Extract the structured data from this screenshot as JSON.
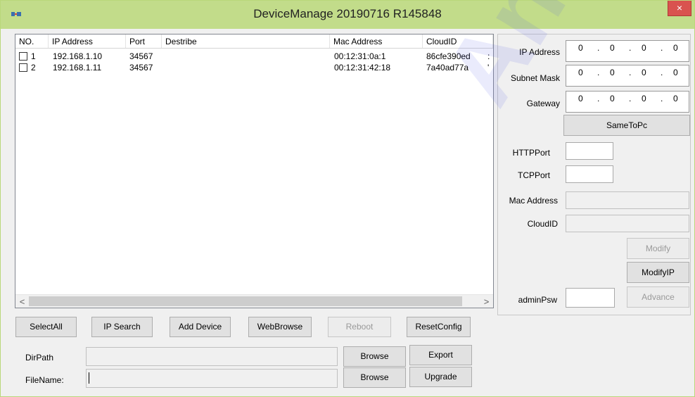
{
  "window": {
    "title": "DeviceManage 20190716 R145848",
    "close_label": "×"
  },
  "listview": {
    "columns": [
      "NO.",
      "IP Address",
      "Port",
      "Destribe",
      "Mac Address",
      "CloudID"
    ],
    "rows": [
      {
        "no": "1",
        "ip": "192.168.1.10",
        "port": "34567",
        "describe": "",
        "mac": "00:12:31:0a:1",
        "cloud": "86cfe390ed",
        "extra": ":"
      },
      {
        "no": "2",
        "ip": "192.168.1.11",
        "port": "34567",
        "describe": "",
        "mac": "00:12:31:42:18",
        "cloud": "7a40ad77a",
        "extra": "'"
      }
    ],
    "scroll_left": "<",
    "scroll_right": ">"
  },
  "network": {
    "ip_label": "IP Address",
    "subnet_label": "Subnet Mask",
    "gateway_label": "Gateway",
    "ip": [
      "0",
      "0",
      "0",
      "0"
    ],
    "subnet": [
      "0",
      "0",
      "0",
      "0"
    ],
    "gateway": [
      "0",
      "0",
      "0",
      "0"
    ],
    "dot": ".",
    "same_to_pc": "SameToPc",
    "http_label": "HTTPPort",
    "tcp_label": "TCPPort",
    "mac_label": "Mac Address",
    "cloud_label": "CloudID",
    "modify": "Modify",
    "modify_ip": "ModifyIP",
    "admin_label": "adminPsw",
    "advance": "Advance"
  },
  "toolbar": {
    "select_all": "SelectAll",
    "ip_search": "IP Search",
    "add_device": "Add Device",
    "web_browse": "WebBrowse",
    "reboot": "Reboot",
    "reset_config": "ResetConfig"
  },
  "files": {
    "dirpath_label": "DirPath",
    "filename_label": "FileName:",
    "browse1": "Browse",
    "browse2": "Browse",
    "export": "Export",
    "upgrade": "Upgrade"
  },
  "watermark": {
    "text": "Anntek"
  },
  "colors": {
    "titlebar": "#c2dc8a",
    "close": "#d9534f",
    "window": "#f0f0f0"
  }
}
